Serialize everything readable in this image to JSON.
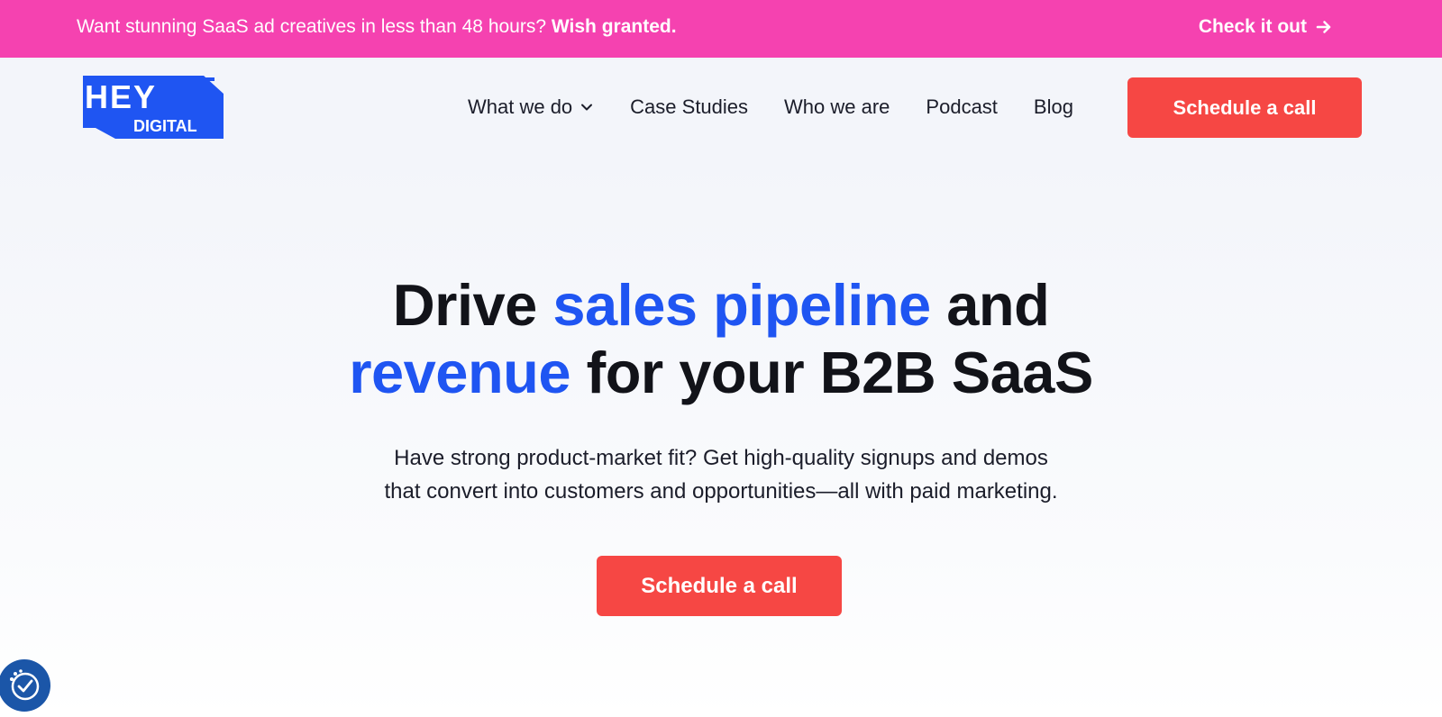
{
  "promo": {
    "text": "Want stunning SaaS ad creatives in less than 48 hours?",
    "highlight": "Wish granted.",
    "cta_label": "Check it out",
    "cta_icon": "arrow-right-icon",
    "background": "#f542b0"
  },
  "header": {
    "logo_alt": "HEY DIGITAL",
    "logo_top": "HEY",
    "logo_bottom": "DIGITAL",
    "nav": [
      {
        "label": "What we do",
        "has_dropdown": true
      },
      {
        "label": "Case Studies"
      },
      {
        "label": "Who we are"
      },
      {
        "label": "Podcast"
      },
      {
        "label": "Blog"
      }
    ],
    "cta_label": "Schedule a call"
  },
  "hero": {
    "headline_part1": "Drive ",
    "headline_highlight1": "sales pipeline",
    "headline_part2": " and",
    "headline_highlight2": "revenue",
    "headline_part3": " for your B2B SaaS",
    "subhead_line1": "Have strong product-market fit? Get high-quality signups and demos",
    "subhead_line2": "that convert into customers and opportunities—all with paid marketing.",
    "cta_label": "Schedule a call"
  },
  "accessibility": {
    "icon": "accessibility-icon"
  },
  "colors": {
    "accent_blue": "#1f55f2",
    "cta_red": "#f64744",
    "banner_pink": "#f542b0",
    "text_dark": "#121319"
  }
}
